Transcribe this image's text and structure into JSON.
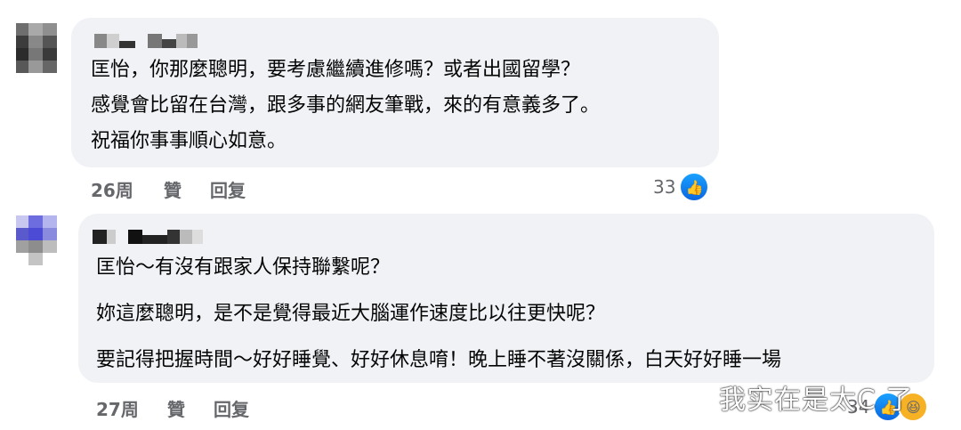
{
  "comments": [
    {
      "text_lines": [
        "匡怡，你那麼聰明，要考慮繼續進修嗎？或者出國留學？",
        "感覺會比留在台灣，跟多事的網友筆戰，來的有意義多了。",
        "祝福你事事順心如意。"
      ],
      "time": "26周",
      "like_label": "贊",
      "reply_label": "回复",
      "reaction_count": "33",
      "reaction_icons": [
        "like-icon"
      ]
    },
    {
      "text_lines": [
        "匡怡～有沒有跟家人保持聯繫呢？",
        "妳這麼聰明，是不是覺得最近大腦運作速度比以往更快呢？",
        "要記得把握時間～好好睡覺、好好休息唷！晚上睡不著沒關係，白天好好睡一場"
      ],
      "time": "27周",
      "like_label": "贊",
      "reply_label": "回复",
      "reaction_count": "34",
      "reaction_icons": [
        "like-icon",
        "haha-icon"
      ]
    }
  ],
  "watermark": "我实在是太C 了",
  "colors": {
    "bubble": "#f0f2f5",
    "meta_text": "#65676b",
    "like_blue": "#1877f2"
  }
}
